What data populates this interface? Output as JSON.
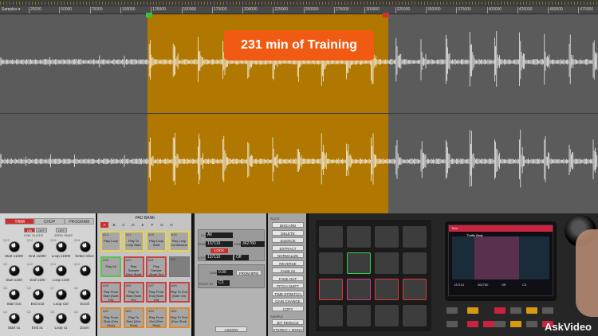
{
  "promo": {
    "text": "231 min of Training"
  },
  "ruler": {
    "units_label": "Samples ▾",
    "ticks": [
      "25000",
      "50000",
      "75000",
      "100000",
      "125000",
      "150000",
      "175000",
      "200000",
      "225000",
      "250000",
      "275000",
      "300000",
      "325000",
      "350000",
      "375000",
      "400000",
      "425000",
      "450000",
      "475000"
    ]
  },
  "mode_tabs": [
    "TRIM",
    "CHOP",
    "PROGRAM"
  ],
  "toggles": {
    "link_slices": {
      "on": "ON",
      "off": "OFF",
      "label": "LINK SLICES"
    },
    "zero_snap": {
      "off": "OFF",
      "label": "ZERO SNAP"
    }
  },
  "knobs": [
    {
      "id": "Q13",
      "label": "Start x1000"
    },
    {
      "id": "Q14",
      "label": "End x1000"
    },
    {
      "id": "Q15",
      "label": "Loop x1000"
    },
    {
      "id": "Q16",
      "label": "Select Slice"
    },
    {
      "id": "Q9",
      "label": "Start x100"
    },
    {
      "id": "Q10",
      "label": "End x100"
    },
    {
      "id": "Q11",
      "label": "Loop x100"
    },
    {
      "id": "Q12",
      "label": ""
    },
    {
      "id": "Q5",
      "label": "Start x10"
    },
    {
      "id": "Q6",
      "label": "End x10"
    },
    {
      "id": "Q7",
      "label": "Loop x10"
    },
    {
      "id": "Q8",
      "label": "Scroll"
    },
    {
      "id": "Q1",
      "label": "Start x1"
    },
    {
      "id": "Q2",
      "label": "End x1"
    },
    {
      "id": "Q3",
      "label": "Loop x1"
    },
    {
      "id": "Q4",
      "label": "Zoom"
    }
  ],
  "pad_bank": {
    "title": "PAD BANK",
    "banks": [
      "A",
      "B",
      "C",
      "D",
      "E",
      "F",
      "G",
      "H"
    ],
    "pads": [
      {
        "id": "A13",
        "label": "Play Loop",
        "color": "yellow"
      },
      {
        "id": "A14",
        "label": "Play To Loop Start",
        "color": "yellow"
      },
      {
        "id": "A15",
        "label": "Play Loop Start",
        "color": "yellow"
      },
      {
        "id": "A16",
        "label": "Play Loop Continuous",
        "color": "yellow"
      },
      {
        "id": "A09",
        "label": "Play All",
        "color": "green"
      },
      {
        "id": "A10",
        "label": "Play Sample (One Shot)",
        "color": "red"
      },
      {
        "id": "A11",
        "label": "Play Sample (Note On)",
        "color": "red"
      },
      {
        "id": "A12",
        "label": "",
        "color": "none"
      },
      {
        "id": "A05",
        "label": "Play From Start (Note On)",
        "color": "red"
      },
      {
        "id": "A06",
        "label": "Play To Start (Note On)",
        "color": "red"
      },
      {
        "id": "A07",
        "label": "Play From End (Note On)",
        "color": "red"
      },
      {
        "id": "A08",
        "label": "Play To End (Note On)",
        "color": "red"
      },
      {
        "id": "A01",
        "label": "Play From Start (One Shot)",
        "color": "orange"
      },
      {
        "id": "A02",
        "label": "Play To Start (One Shot)",
        "color": "orange"
      },
      {
        "id": "A03",
        "label": "Play From End (One Shot)",
        "color": "orange"
      },
      {
        "id": "A04",
        "label": "Play To End (One Shot)",
        "color": "orange"
      }
    ]
  },
  "slice_settings": {
    "slice_label": "SLICE",
    "slice_value": "All",
    "start_label": "START",
    "start_value": "137110",
    "end_label": "END",
    "end_value": "362760",
    "lock_label": "LOCK",
    "loop_label": "LOOP",
    "loop_value": "137110",
    "loop_mode": "Off",
    "tune_label": "TUNE",
    "tune_value": "0.00",
    "from_bpm": "FROM BPM",
    "root_label": "ROOT NT",
    "root_value": "C3",
    "assign": "ASSIGN"
  },
  "process": {
    "slice_label": "SLICE",
    "slice_ops": [
      "DISCARD",
      "DELETE",
      "SILENCE",
      "EXTRACT",
      "NORMALIZE",
      "REVERSE",
      "FADE IN",
      "FADE OUT",
      "PITCH SHIFT",
      "TIME STRETCH",
      "GAIN CHANGE",
      "COPY"
    ],
    "sample_label": "SAMPLE",
    "sample_ops": [
      "BIT REDUCE",
      "STEREO > MONO"
    ]
  },
  "hardware": {
    "screen_title": "Trim",
    "screen_file": "Thrifty Beat",
    "stats": [
      "137110",
      "362760",
      "Off",
      "C3"
    ],
    "watermark": "AskVideo"
  },
  "colors": {
    "selection": "#b07800",
    "promo": "#f15a12",
    "accent_red": "#c92f2f",
    "waveform": "#ffffff"
  }
}
